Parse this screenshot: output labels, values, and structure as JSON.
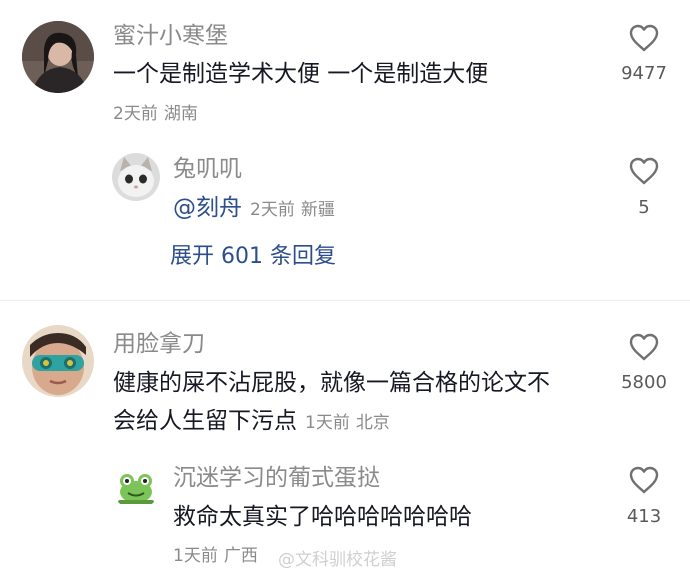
{
  "comments": [
    {
      "username": "蜜汁小寒堡",
      "text": "一个是制造学术大便 一个是制造大便",
      "time": "2天前",
      "location": "湖南",
      "likes": "9477"
    },
    {
      "username": "兔叽叽",
      "mention": "@刻舟",
      "time": "2天前",
      "location": "新疆",
      "likes": "5",
      "expand_label": "展开 601 条回复"
    },
    {
      "username": "用脸拿刀",
      "text_line1": "健康的屎不沾屁股，就像一篇合格的论文不",
      "text_line2": "会给人生留下污点",
      "time": "1天前",
      "location": "北京",
      "likes": "5800"
    },
    {
      "username": "沉迷学习的葡式蛋挞",
      "text": "救命太真实了哈哈哈哈哈哈哈",
      "time": "1天前",
      "location": "广西",
      "likes": "413"
    }
  ],
  "watermark": "@文科驯校花酱",
  "colors": {
    "username": "#8a8a8a",
    "text": "#161823",
    "link": "#2c4e8c"
  }
}
